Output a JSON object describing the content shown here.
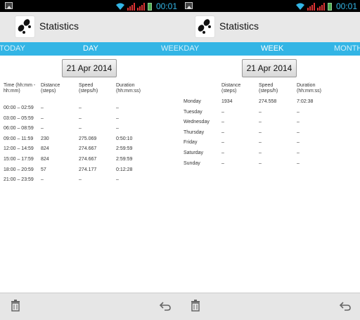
{
  "status": {
    "clock": "00:01"
  },
  "app": {
    "title": "Statistics"
  },
  "left": {
    "tabs": [
      {
        "label": "TODAY",
        "active": false
      },
      {
        "label": "DAY",
        "active": true
      },
      {
        "label": "WEEKDAY",
        "active": false
      }
    ],
    "date_label": "21 Apr 2014",
    "headers": [
      "Time (hh:mm - hh:mm)",
      "Distance (steps)",
      "Speed (steps/h)",
      "Duration (hh:mm:ss)"
    ],
    "rows": [
      [
        "00:00 – 02:59",
        "–",
        "–",
        "–"
      ],
      [
        "03:00 – 05:59",
        "–",
        "–",
        "–"
      ],
      [
        "06:00 – 08:59",
        "–",
        "–",
        "–"
      ],
      [
        "09:00 – 11:59",
        "230",
        "275.069",
        "0:50:10"
      ],
      [
        "12:00 – 14:59",
        "824",
        "274.667",
        "2:59:59"
      ],
      [
        "15:00 – 17:59",
        "824",
        "274.667",
        "2:59:59"
      ],
      [
        "18:00 – 20:59",
        "57",
        "274.177",
        "0:12:28"
      ],
      [
        "21:00 – 23:59",
        "–",
        "–",
        "–"
      ]
    ]
  },
  "right": {
    "tabs": [
      {
        "label": "WEEKDAY",
        "active": false
      },
      {
        "label": "WEEK",
        "active": true
      },
      {
        "label": "MONTH",
        "active": false
      }
    ],
    "date_label": "21 Apr 2014",
    "headers": [
      "",
      "Distance (steps)",
      "Speed (steps/h)",
      "Duration (hh:mm:ss)"
    ],
    "rows": [
      [
        "Monday",
        "1934",
        "274.558",
        "7:02:38"
      ],
      [
        "Tuesday",
        "–",
        "–",
        "–"
      ],
      [
        "Wednesday",
        "–",
        "–",
        "–"
      ],
      [
        "Thursday",
        "–",
        "–",
        "–"
      ],
      [
        "Friday",
        "–",
        "–",
        "–"
      ],
      [
        "Saturday",
        "–",
        "–",
        "–"
      ],
      [
        "Sunday",
        "–",
        "–",
        "–"
      ]
    ]
  },
  "icons": {
    "app": "footprints-icon",
    "delete": "trash-icon",
    "back": "undo-icon"
  },
  "colors": {
    "tab_bar": "#33b5e5",
    "clock": "#33b5e5",
    "action_bar": "#e8e8e8"
  }
}
